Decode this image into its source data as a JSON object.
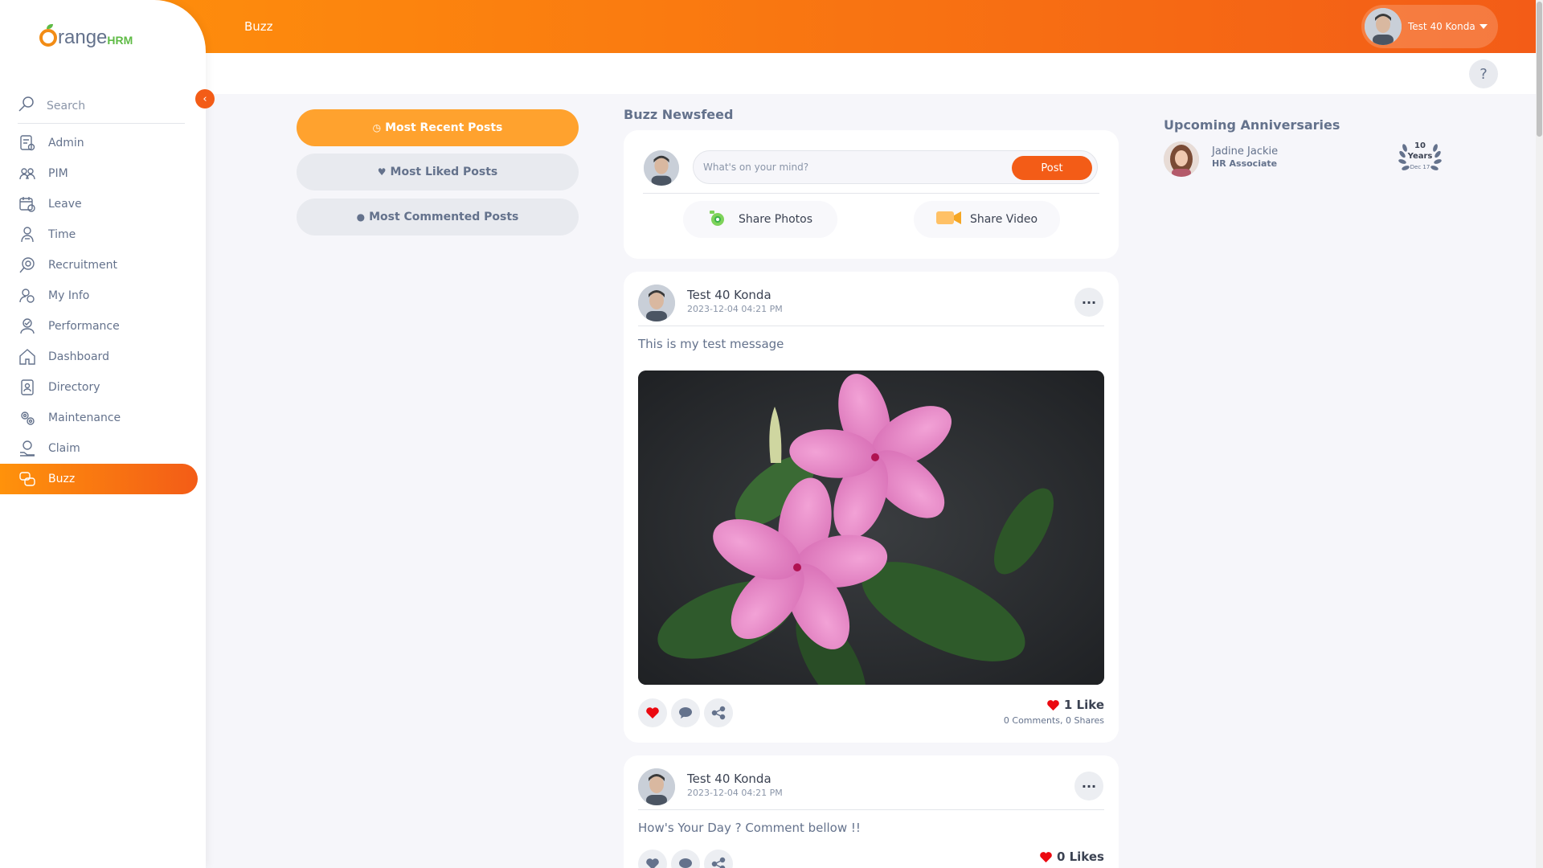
{
  "header": {
    "title": "Buzz",
    "user_name": "Test 40 Konda",
    "help_label": "?"
  },
  "brand": {
    "logo_text": "range",
    "logo_suffix": "HRM",
    "colors": {
      "accent": "#f35c17",
      "accent_light": "#ff920b",
      "green": "#5fbb46"
    }
  },
  "sidebar": {
    "search_label": "Search",
    "items": [
      {
        "label": "Admin",
        "icon": "admin-icon",
        "active": false
      },
      {
        "label": "PIM",
        "icon": "pim-icon",
        "active": false
      },
      {
        "label": "Leave",
        "icon": "leave-icon",
        "active": false
      },
      {
        "label": "Time",
        "icon": "time-icon",
        "active": false
      },
      {
        "label": "Recruitment",
        "icon": "recruitment-icon",
        "active": false
      },
      {
        "label": "My Info",
        "icon": "my-info-icon",
        "active": false
      },
      {
        "label": "Performance",
        "icon": "performance-icon",
        "active": false
      },
      {
        "label": "Dashboard",
        "icon": "dashboard-icon",
        "active": false
      },
      {
        "label": "Directory",
        "icon": "directory-icon",
        "active": false
      },
      {
        "label": "Maintenance",
        "icon": "maintenance-icon",
        "active": false
      },
      {
        "label": "Claim",
        "icon": "claim-icon",
        "active": false
      },
      {
        "label": "Buzz",
        "icon": "buzz-icon",
        "active": true
      }
    ]
  },
  "filters": {
    "most_recent": "Most Recent Posts",
    "most_liked": "Most Liked Posts",
    "most_commented": "Most Commented Posts"
  },
  "feed": {
    "title": "Buzz Newsfeed",
    "compose": {
      "placeholder": "What's on your mind?",
      "post_label": "Post",
      "share_photos": "Share Photos",
      "share_video": "Share Video"
    },
    "posts": [
      {
        "author": "Test 40 Konda",
        "date": "2023-12-04 04:21 PM",
        "text": "This is my test message",
        "likes": "1 Like",
        "comments": "0 Comments",
        "shares": "0 Shares",
        "liked": true
      },
      {
        "author": "Test 40 Konda",
        "date": "2023-12-04 04:21 PM",
        "text": "How's Your Day ? Comment bellow !!",
        "likes": "0 Likes",
        "liked": false
      }
    ]
  },
  "anniversaries": {
    "title": "Upcoming Anniversaries",
    "items": [
      {
        "name": "Jadine Jackie",
        "role": "HR Associate",
        "years": "10",
        "years_label": "Years",
        "date": "Dec 17"
      }
    ]
  }
}
